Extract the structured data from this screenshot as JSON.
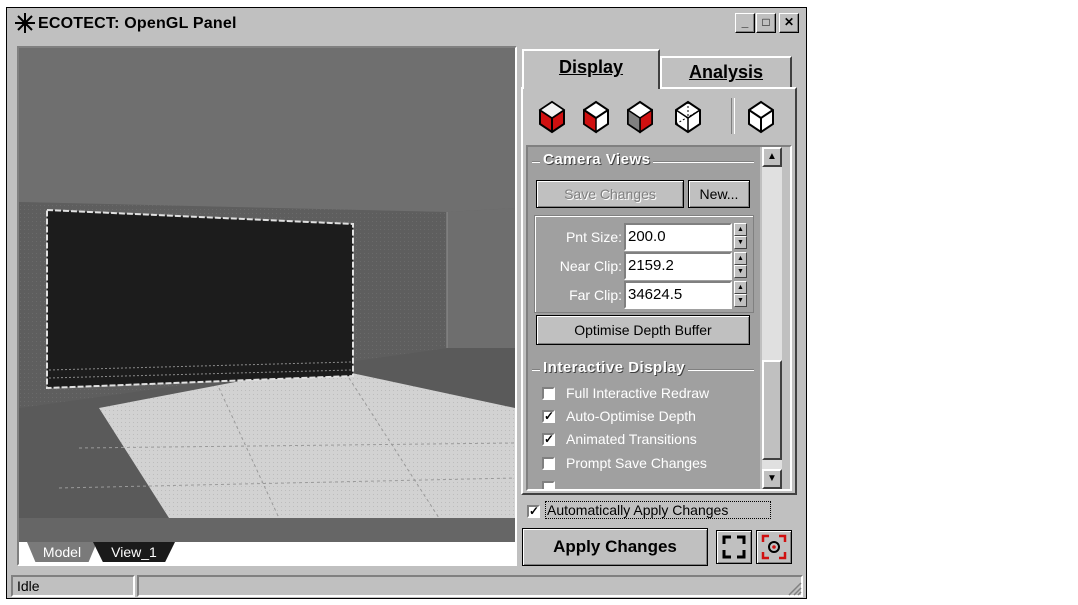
{
  "window": {
    "title": "ECOTECT: OpenGL Panel",
    "controls": {
      "minimize": "_",
      "maximize": "□",
      "close": "✕"
    }
  },
  "viewport": {
    "tabs": [
      {
        "label": "Model"
      },
      {
        "label": "View_1"
      }
    ]
  },
  "panel_tabs": [
    {
      "label": "Display",
      "active": true
    },
    {
      "label": "Analysis",
      "active": false
    }
  ],
  "display_icons": [
    "solid-shaded-cube-icon",
    "red-face-cube-icon",
    "half-shaded-cube-icon",
    "wireframe-cube-icon",
    "plain-cube-icon"
  ],
  "camera_views": {
    "title": "Camera Views",
    "save_changes_label": "Save Changes",
    "new_label": "New...",
    "fields": [
      {
        "label": "Pnt Size:",
        "value": "200.0"
      },
      {
        "label": "Near Clip:",
        "value": "2159.2"
      },
      {
        "label": "Far Clip:",
        "value": "34624.5"
      }
    ],
    "optimise_label": "Optimise Depth Buffer"
  },
  "interactive_display": {
    "title": "Interactive Display",
    "options": [
      {
        "label": "Full Interactive Redraw",
        "checked": false
      },
      {
        "label": "Auto-Optimise Depth",
        "checked": true
      },
      {
        "label": "Animated Transitions",
        "checked": true
      },
      {
        "label": "Prompt Save Changes",
        "checked": false
      }
    ]
  },
  "auto_apply": {
    "label": "Automatically Apply Changes",
    "checked": true
  },
  "apply_label": "Apply Changes",
  "status": {
    "text": "Idle"
  },
  "colors": {
    "accent_red": "#d01010",
    "panel_gray": "#a0a0a0",
    "face_gray": "#c0c0c0"
  }
}
